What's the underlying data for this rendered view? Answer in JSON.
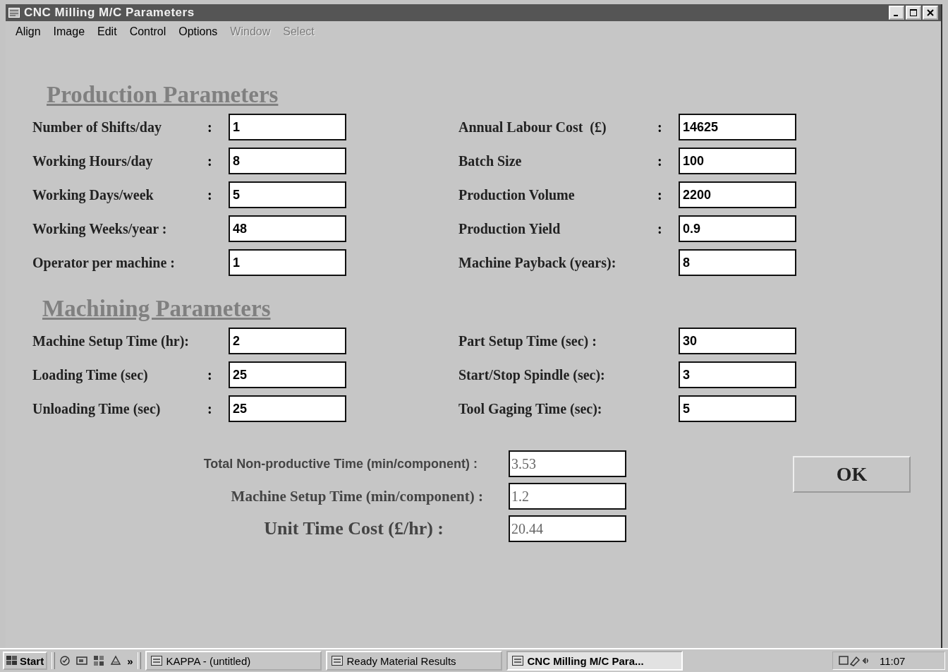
{
  "window": {
    "title": "CNC Milling M/C Parameters"
  },
  "menu": [
    {
      "label": "Align",
      "disabled": false
    },
    {
      "label": "Image",
      "disabled": false
    },
    {
      "label": "Edit",
      "disabled": false
    },
    {
      "label": "Control",
      "disabled": false
    },
    {
      "label": "Options",
      "disabled": false
    },
    {
      "label": "Window",
      "disabled": true
    },
    {
      "label": "Select",
      "disabled": true
    }
  ],
  "sections": [
    {
      "heading": "Production Parameters",
      "left": [
        {
          "label": "Number of Shifts/day",
          "separator": ":",
          "value": "1"
        },
        {
          "label": "Working Hours/day",
          "separator": ":",
          "value": "8"
        },
        {
          "label": "Working Days/week",
          "separator": ":",
          "value": "5"
        },
        {
          "label": "Working Weeks/year :",
          "value": "48"
        },
        {
          "label": "Operator per machine :",
          "value": "1"
        }
      ],
      "right": [
        {
          "label": "Annual Labour Cost  (£)",
          "separator": ":",
          "value": "14625"
        },
        {
          "label": "Batch Size",
          "separator": ":",
          "value": "100"
        },
        {
          "label": "Production Volume",
          "separator": ":",
          "value": "2200"
        },
        {
          "label": "Production Yield",
          "separator": ":",
          "value": "0.9"
        },
        {
          "label": "Machine Payback (years):",
          "value": "8"
        }
      ]
    },
    {
      "heading": "Machining Parameters",
      "left": [
        {
          "label": "Machine Setup Time (hr):",
          "value": "2"
        },
        {
          "label": "Loading Time (sec)",
          "separator": ":",
          "value": "25"
        },
        {
          "label": "Unloading Time (sec)",
          "separator": ":",
          "value": "25"
        }
      ],
      "right": [
        {
          "label": "Part Setup Time (sec) :",
          "value": "30"
        },
        {
          "label": "Start/Stop Spindle (sec):",
          "value": "3"
        },
        {
          "label": "Tool Gaging Time (sec):",
          "value": "5"
        }
      ]
    }
  ],
  "results": [
    {
      "kind": "sans",
      "label": "Total Non-productive Time (min/component) :",
      "value": "3.53"
    },
    {
      "kind": "serif",
      "label": "Machine Setup Time (min/component) :",
      "value": "1.2"
    },
    {
      "kind": "large",
      "label": "Unit Time Cost (£/hr) :",
      "value": "20.44"
    }
  ],
  "ok_button": "OK",
  "taskbar": {
    "start": "Start",
    "more": "»",
    "tasks": [
      {
        "label": "KAPPA - (untitled)",
        "selected": false
      },
      {
        "label": "Ready Material Results",
        "selected": false
      },
      {
        "label": "CNC Milling M/C Para...",
        "selected": true
      }
    ],
    "clock": "11:07"
  }
}
